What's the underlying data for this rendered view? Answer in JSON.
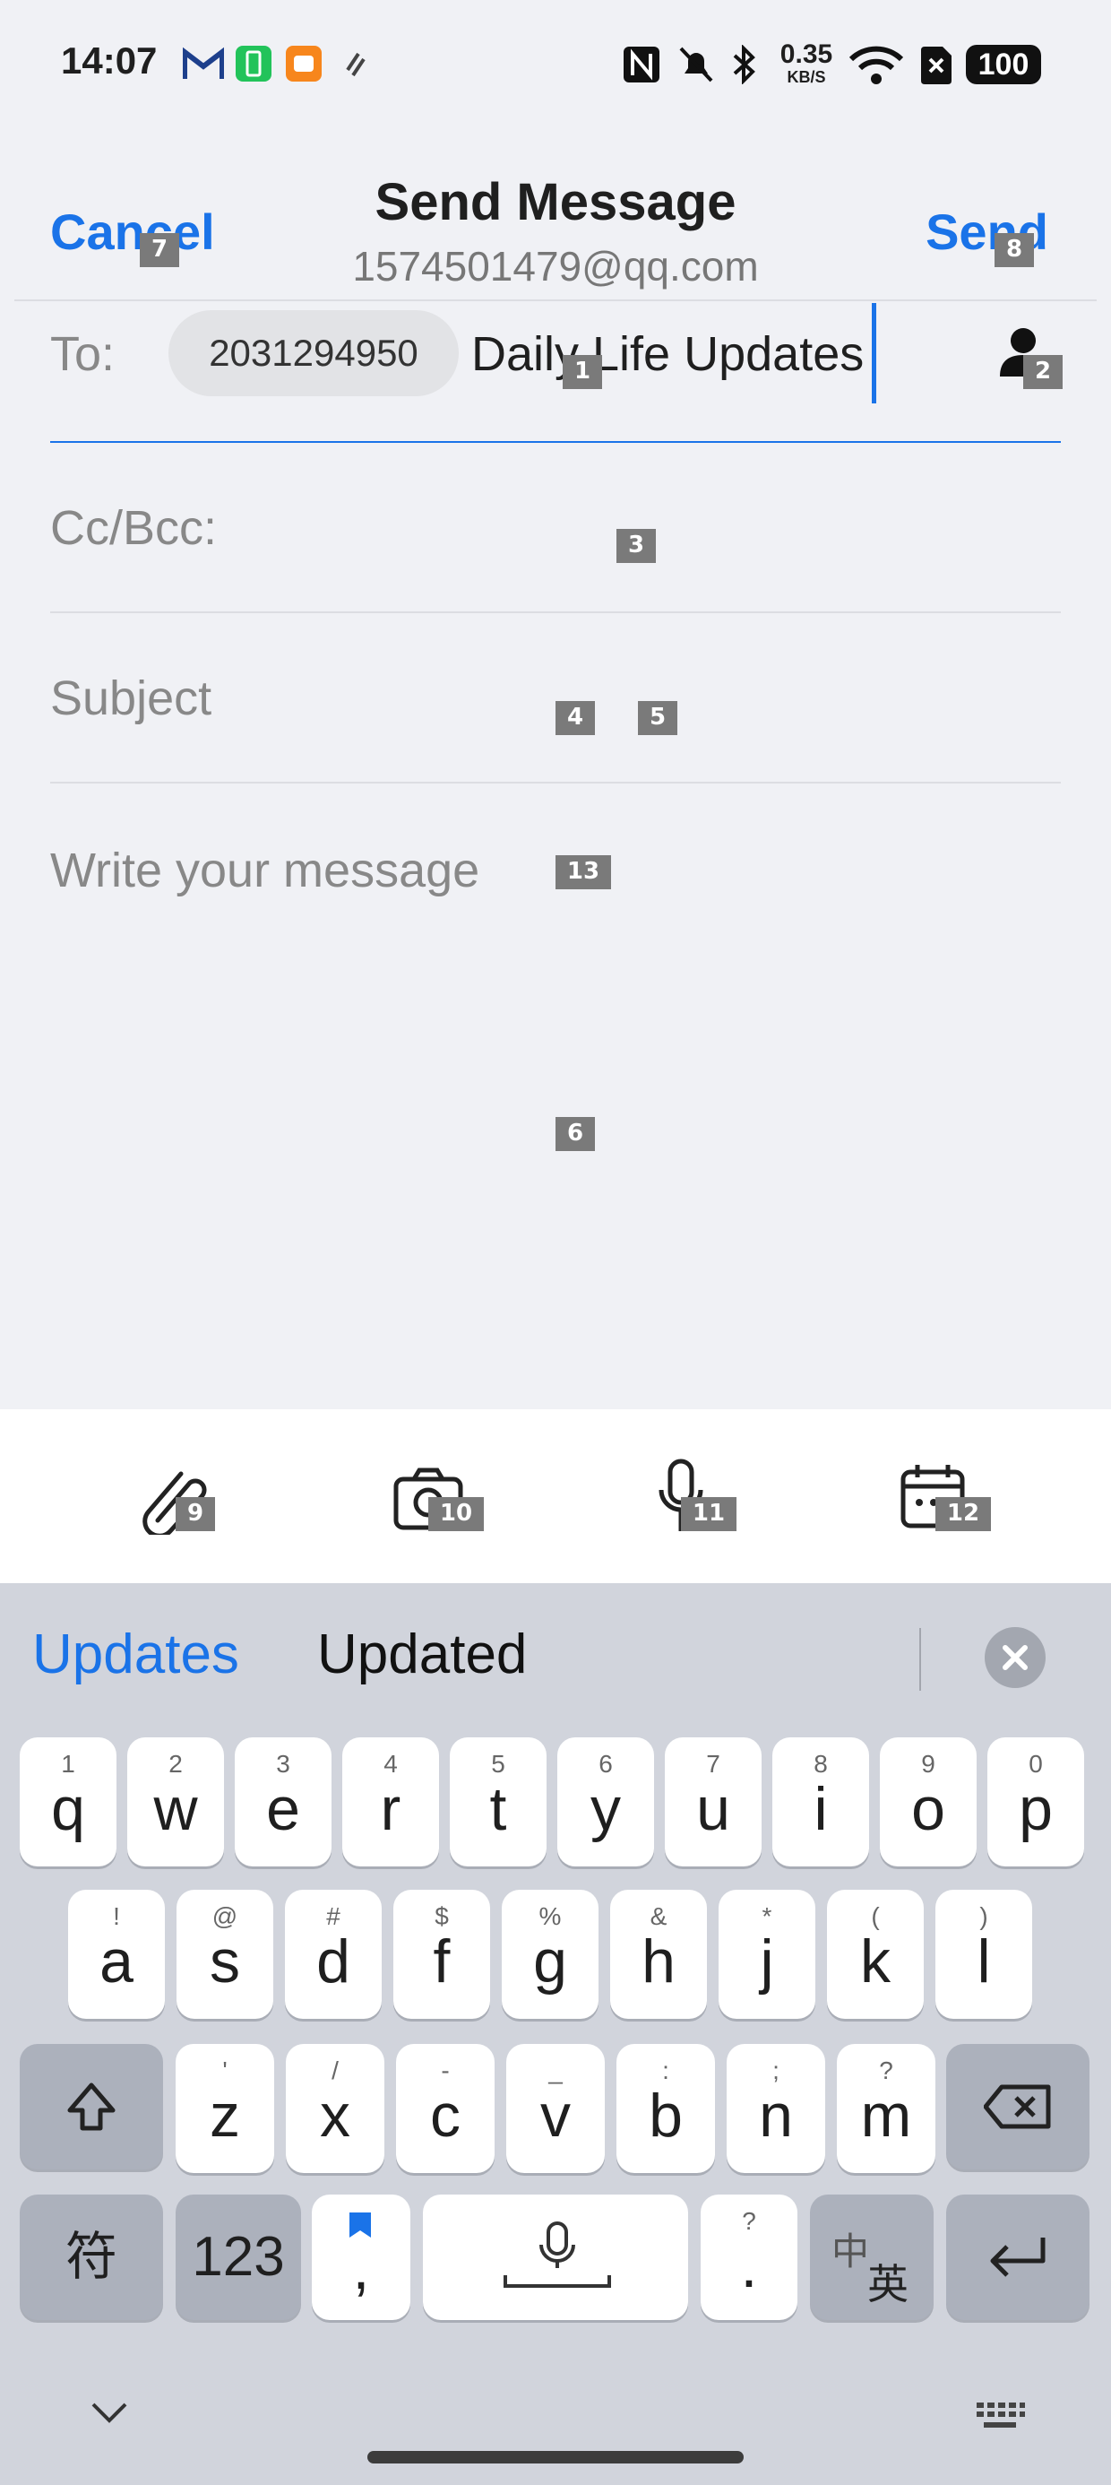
{
  "status_bar": {
    "time": "14:07",
    "speed_value": "0.35",
    "speed_unit": "KB/S",
    "battery": "100"
  },
  "header": {
    "cancel_label": "Cancel",
    "title": "Send Message",
    "from_email": "1574501479@qq.com",
    "send_label": "Send"
  },
  "form": {
    "to_label": "To:",
    "to_chip": "2031294950",
    "to_input_value": "Daily Life Updates",
    "cc_bcc_label": "Cc/Bcc:",
    "subject_placeholder": "Subject",
    "message_placeholder": "Write your message"
  },
  "toolbar": {
    "items": [
      "paperclip-icon",
      "camera-icon",
      "microphone-icon",
      "calendar-icon"
    ]
  },
  "keyboard": {
    "suggestions": [
      "Updates",
      "Updated"
    ],
    "row1": [
      [
        "1",
        "q"
      ],
      [
        "2",
        "w"
      ],
      [
        "3",
        "e"
      ],
      [
        "4",
        "r"
      ],
      [
        "5",
        "t"
      ],
      [
        "6",
        "y"
      ],
      [
        "7",
        "u"
      ],
      [
        "8",
        "i"
      ],
      [
        "9",
        "o"
      ],
      [
        "0",
        "p"
      ]
    ],
    "row2": [
      [
        "!",
        "a"
      ],
      [
        "@",
        "s"
      ],
      [
        "#",
        "d"
      ],
      [
        "$",
        "f"
      ],
      [
        "%",
        "g"
      ],
      [
        "&",
        "h"
      ],
      [
        "*",
        "j"
      ],
      [
        "(",
        "k"
      ],
      [
        ")",
        "l"
      ]
    ],
    "row3": [
      [
        "'",
        "z"
      ],
      [
        "/",
        "x"
      ],
      [
        "-",
        "c"
      ],
      [
        "_",
        "v"
      ],
      [
        ":",
        "b"
      ],
      [
        ";",
        "n"
      ],
      [
        "?",
        "m"
      ]
    ],
    "symbols_label": "符",
    "numbers_label": "123",
    "comma_label": ",",
    "period_hint": "?",
    "period_label": ".",
    "lang_top": "中",
    "lang_bottom": "英"
  },
  "markers": [
    "1",
    "2",
    "3",
    "4",
    "5",
    "6",
    "7",
    "8",
    "9",
    "10",
    "11",
    "12",
    "13"
  ],
  "colors": {
    "accent": "#1a73e8",
    "background": "#f0f1f5",
    "keyboard_bg": "#d1d4dc"
  }
}
